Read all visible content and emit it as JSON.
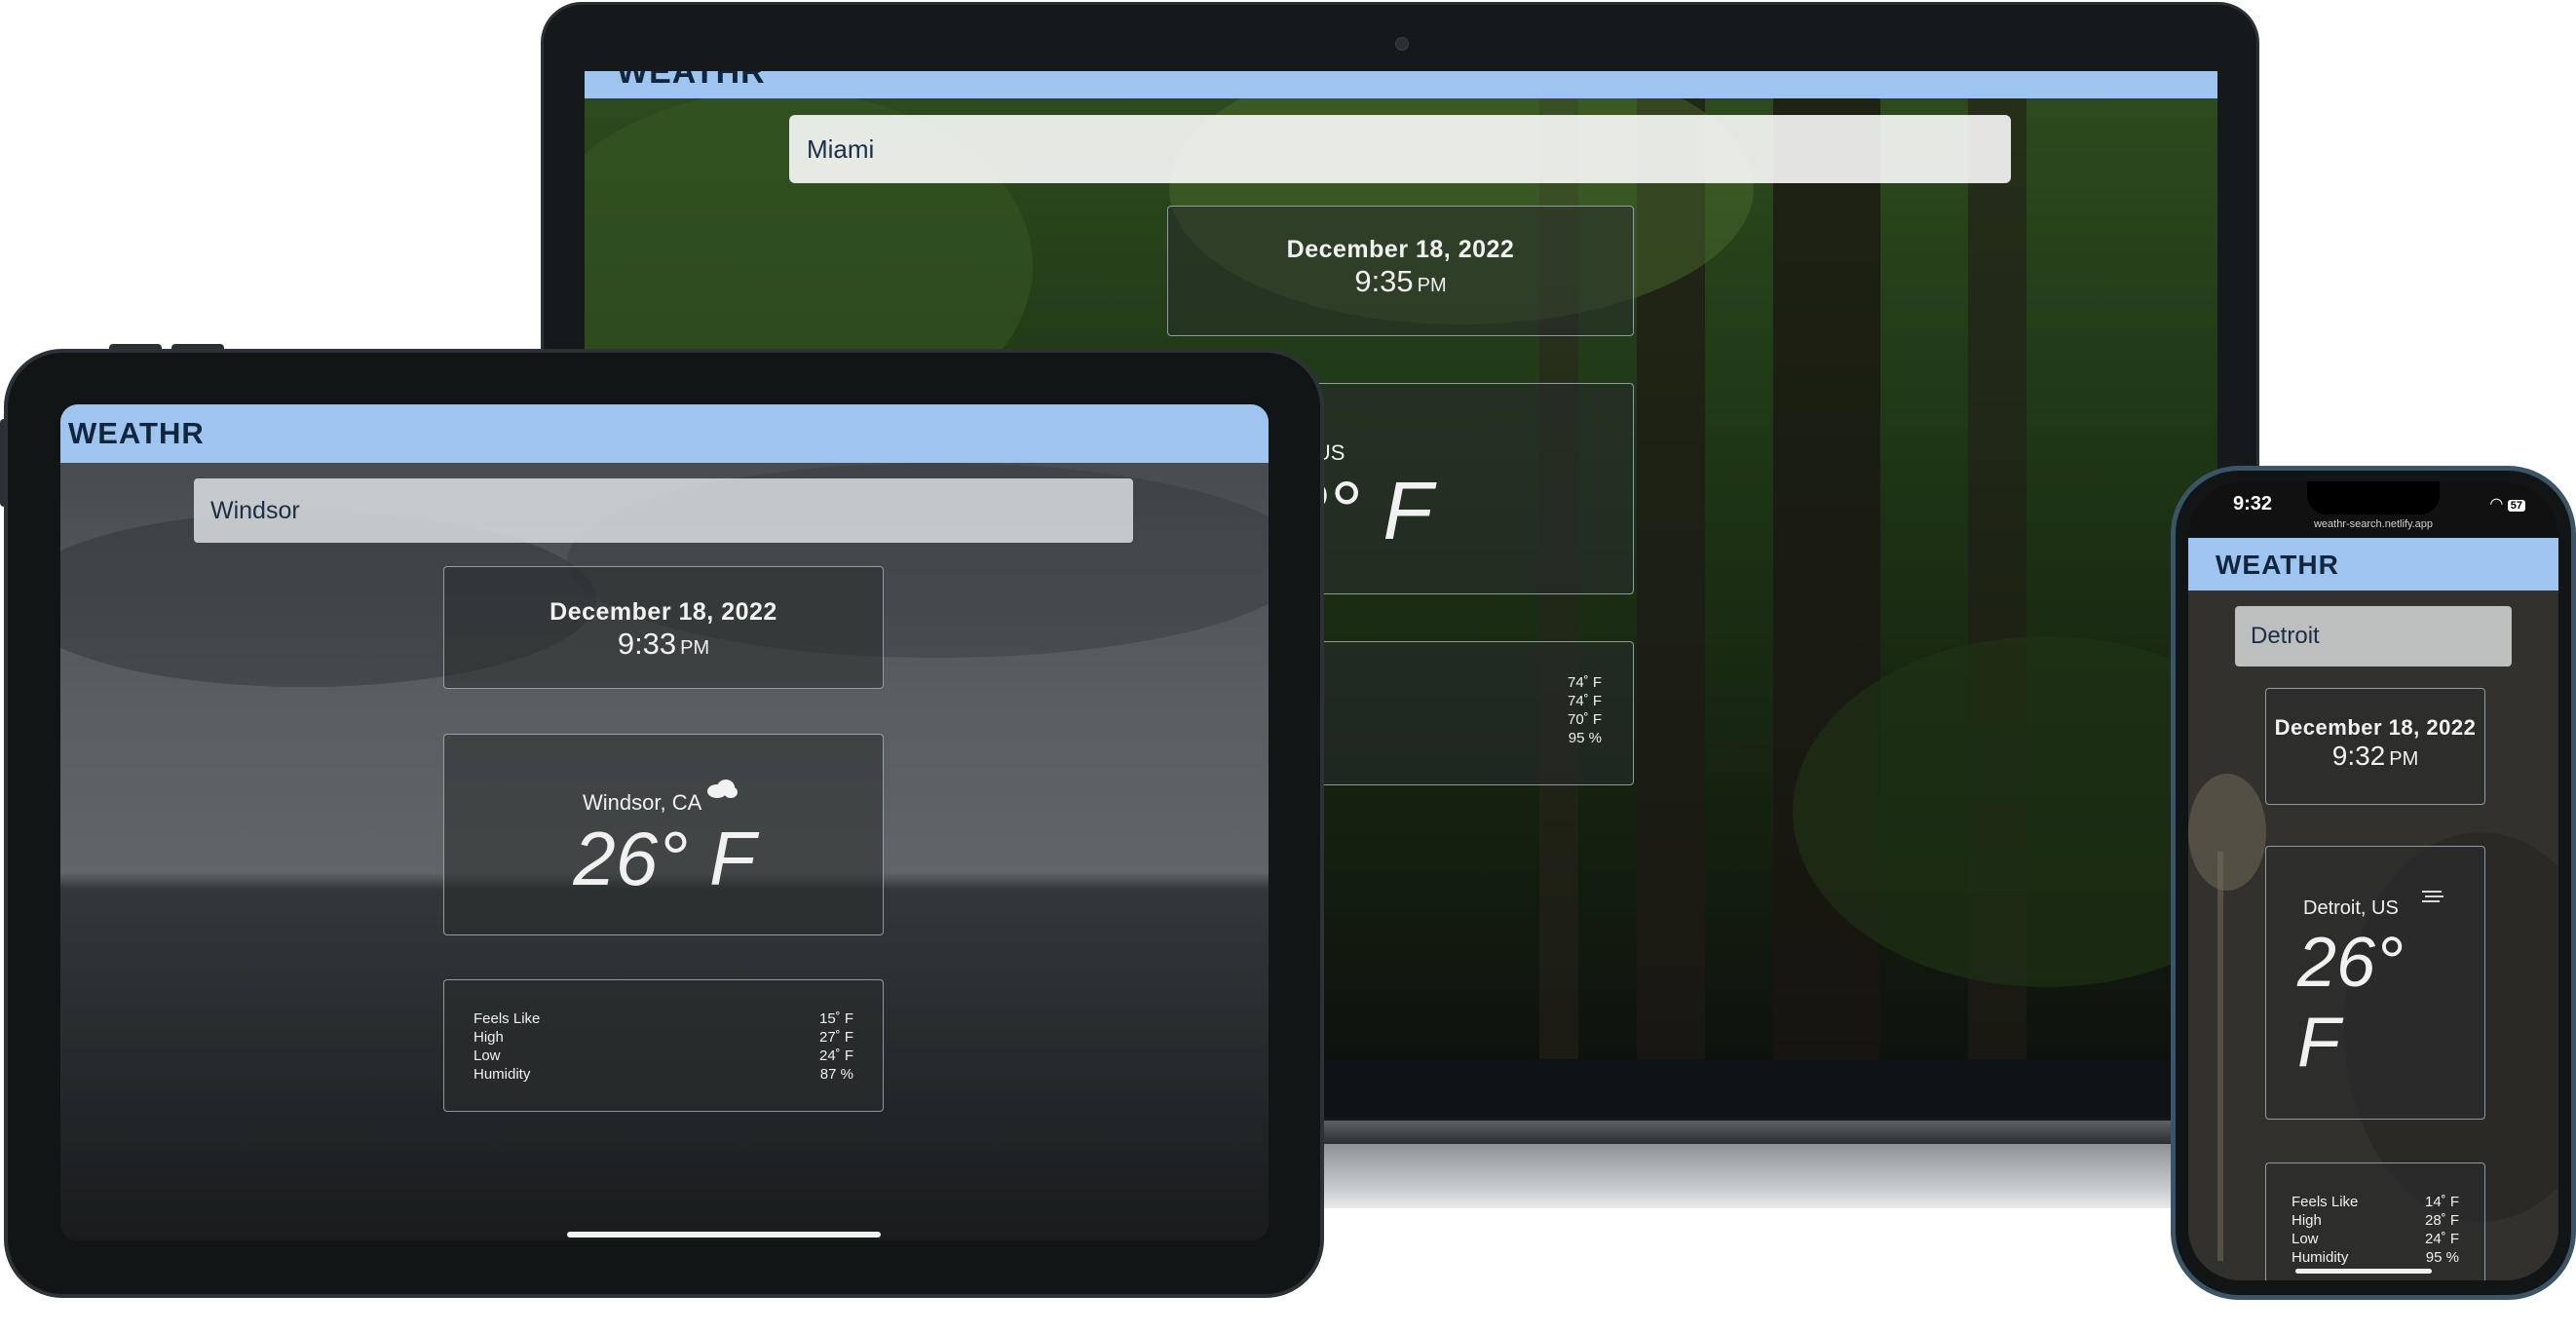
{
  "app": {
    "brand": "WEATHR"
  },
  "laptop": {
    "search_value": "Miami",
    "date": "December 18, 2022",
    "time": "9:35",
    "ampm": "PM",
    "location": "Miami, US",
    "temperature": "73° F",
    "details_values": [
      "74˚ F",
      "74˚ F",
      "70˚ F",
      "95 %"
    ]
  },
  "tablet": {
    "search_value": "Windsor",
    "date": "December 18, 2022",
    "time": "9:33",
    "ampm": "PM",
    "location": "Windsor, CA",
    "weather_icon": "cloud-icon",
    "temperature": "26° F",
    "details": [
      {
        "label": "Feels Like",
        "value": "15˚ F"
      },
      {
        "label": "High",
        "value": "27˚ F"
      },
      {
        "label": "Low",
        "value": "24˚ F"
      },
      {
        "label": "Humidity",
        "value": "87 %"
      }
    ]
  },
  "phone": {
    "status_time": "9:32",
    "url": "weathr-search.netlify.app",
    "battery": "57",
    "search_value": "Detroit",
    "date": "December 18, 2022",
    "time": "9:32",
    "ampm": "PM",
    "location": "Detroit, US",
    "weather_icon": "haze-icon",
    "temperature_line1": "26°",
    "temperature_line2": "F",
    "details": [
      {
        "label": "Feels Like",
        "value": "14˚ F"
      },
      {
        "label": "High",
        "value": "28˚ F"
      },
      {
        "label": "Low",
        "value": "24˚ F"
      },
      {
        "label": "Humidity",
        "value": "95 %"
      }
    ]
  },
  "colors": {
    "header": "#9ec5f0",
    "brand_text": "#11263d",
    "device_frame": "#121516"
  }
}
